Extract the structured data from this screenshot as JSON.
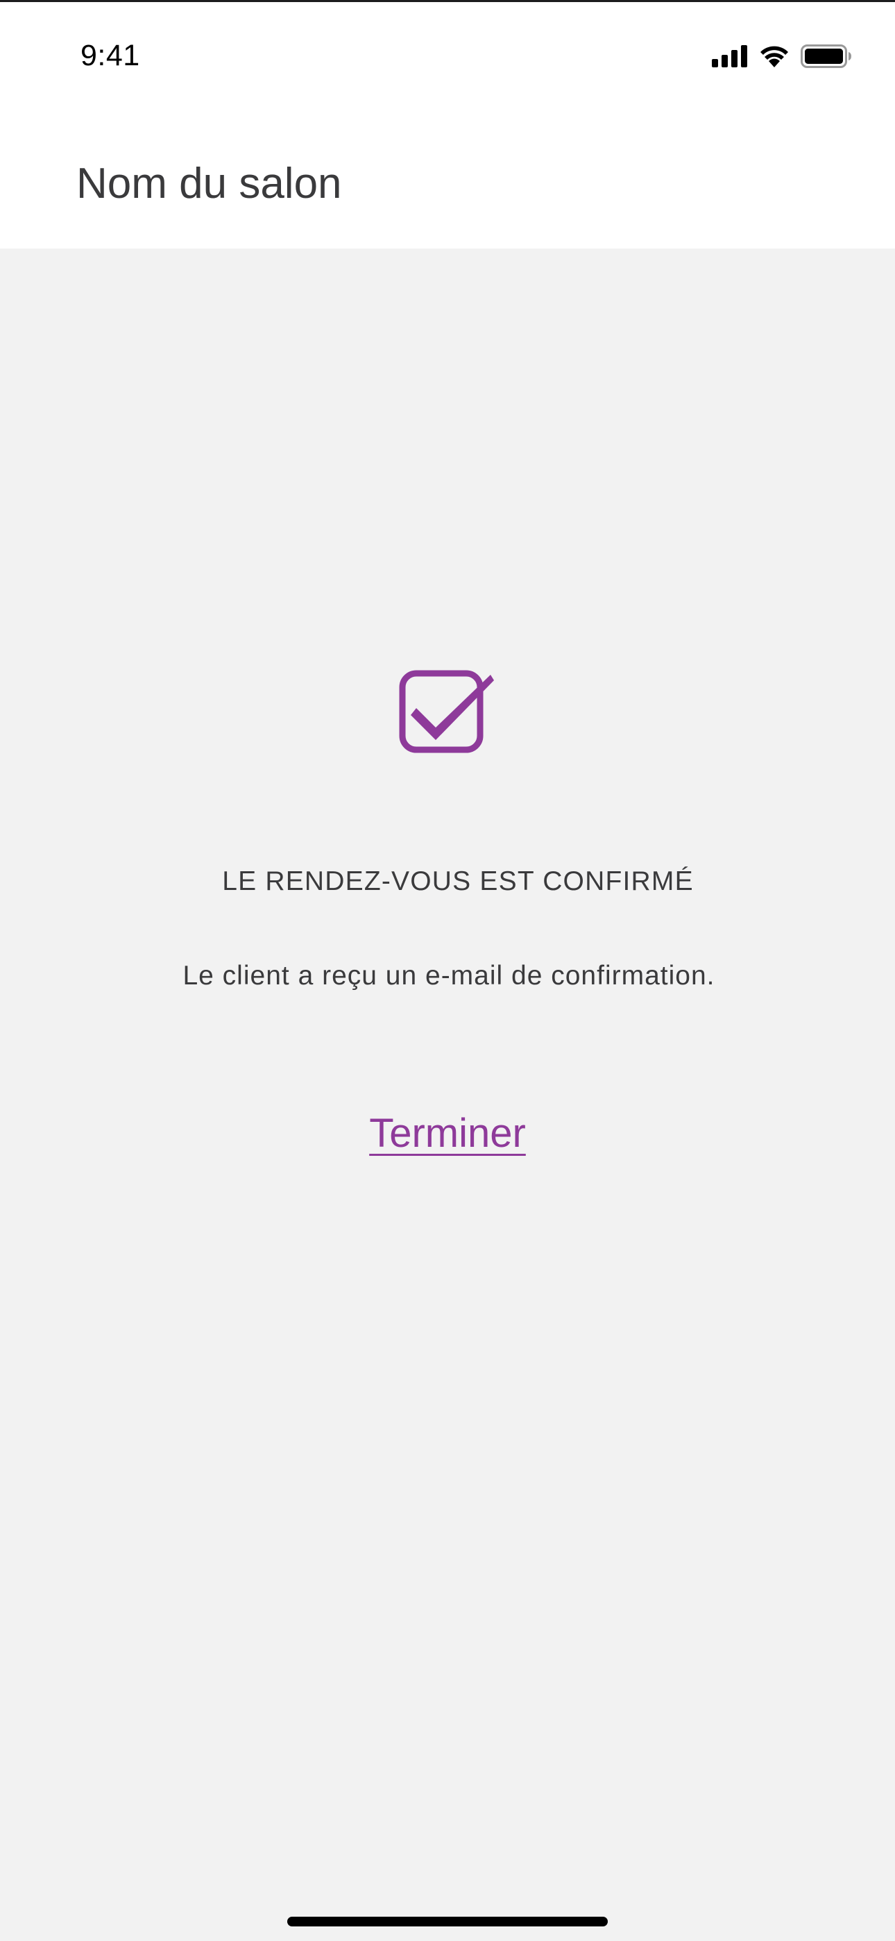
{
  "status_bar": {
    "time": "9:41",
    "icons": [
      "cellular-signal-icon",
      "wifi-icon",
      "battery-icon"
    ]
  },
  "header": {
    "title": "Nom du salon"
  },
  "confirmation": {
    "icon": "checkbox-checked-icon",
    "title": "LE RENDEZ-VOUS EST CONFIRMÉ",
    "message": "Le client a reçu un e-mail de confirmation.",
    "finish_label": "Terminer"
  },
  "colors": {
    "accent": "#8e3a9a",
    "background": "#f2f2f2",
    "header_background": "#ffffff",
    "text": "#3a3a3c"
  }
}
